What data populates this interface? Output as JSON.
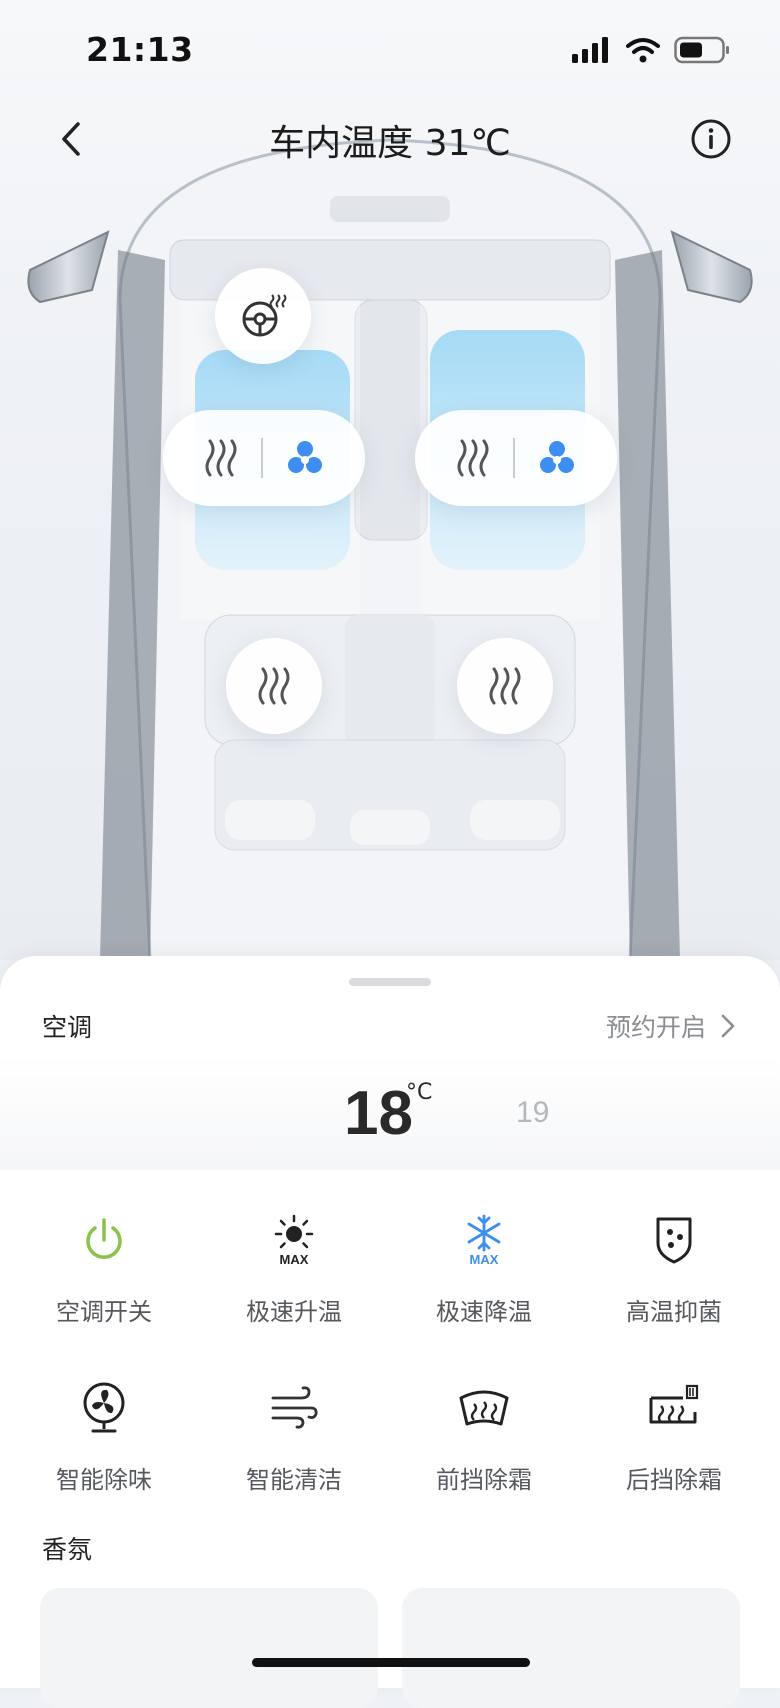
{
  "status": {
    "time": "21:13"
  },
  "header": {
    "title": "车内温度 31℃"
  },
  "seats": {
    "steering_heat": "steering-wheel-heat-icon",
    "front_left": [
      "seat-heat-icon",
      "seat-ventilation-icon"
    ],
    "front_right": [
      "seat-heat-icon",
      "seat-ventilation-icon"
    ],
    "rear_left": "seat-heat-icon",
    "rear_right": "seat-heat-icon"
  },
  "ac": {
    "section_title": "空调",
    "schedule_label": "预约开启",
    "temp_current": "18",
    "temp_unit": "°C",
    "temp_next": "19"
  },
  "functions": [
    {
      "label": "空调开关",
      "icon": "power-icon",
      "color": "#8bc34a"
    },
    {
      "label": "极速升温",
      "icon": "sun-max-icon",
      "color": "#222222"
    },
    {
      "label": "极速降温",
      "icon": "snowflake-max-icon",
      "color": "#3d8ef0"
    },
    {
      "label": "高温抑菌",
      "icon": "shield-dots-icon",
      "color": "#222222"
    },
    {
      "label": "智能除味",
      "icon": "fan-circle-icon",
      "color": "#222222"
    },
    {
      "label": "智能清洁",
      "icon": "wind-icon",
      "color": "#222222"
    },
    {
      "label": "前挡除霜",
      "icon": "front-defrost-icon",
      "color": "#222222"
    },
    {
      "label": "后挡除霜",
      "icon": "rear-defrost-icon",
      "color": "#222222"
    }
  ],
  "aroma": {
    "section_title": "香氛"
  },
  "colors": {
    "accent_blue": "#3d8ef0",
    "power_green": "#8bc34a",
    "seat_cool": "#7cc8f0"
  }
}
